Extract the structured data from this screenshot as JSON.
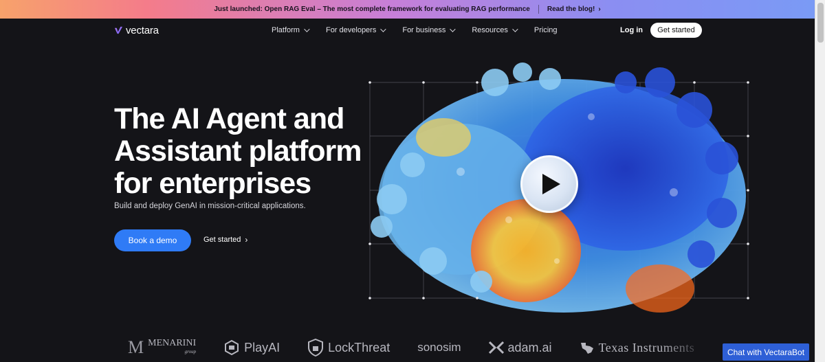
{
  "announcement": {
    "text": "Just launched: Open RAG Eval – The most complete framework for evaluating RAG performance",
    "link": "Read the blog!",
    "chevron": "›"
  },
  "brand": {
    "name": "vectara",
    "mark_icon": "vectara-logo-icon"
  },
  "nav": {
    "items": [
      {
        "label": "Platform",
        "has_dropdown": true
      },
      {
        "label": "For developers",
        "has_dropdown": true
      },
      {
        "label": "For business",
        "has_dropdown": true
      },
      {
        "label": "Resources",
        "has_dropdown": true
      },
      {
        "label": "Pricing",
        "has_dropdown": false
      }
    ],
    "login": "Log in",
    "get_started": "Get started"
  },
  "hero": {
    "title_line1": "The AI Agent and",
    "title_line2": "Assistant platform",
    "title_line3": "for enterprises",
    "subtitle": "Build and deploy GenAI in mission-critical applications.",
    "primary_cta": "Book a demo",
    "secondary_cta": "Get started",
    "secondary_chevron": "›",
    "video_play_icon": "play-icon"
  },
  "customer_logos": [
    {
      "name": "MENARINI",
      "sub": "group",
      "mark": "M"
    },
    {
      "name": "PlayAI"
    },
    {
      "name": "LockThreat"
    },
    {
      "name": "sonosim"
    },
    {
      "name": "adam.ai"
    },
    {
      "name": "Texas Instruments"
    }
  ],
  "chat_widget": {
    "label": "Chat with VectaraBot"
  },
  "colors": {
    "background": "#141418",
    "accent_blue": "#2f7bf6",
    "chat_blue": "#2e5fd6",
    "announce_gradient": [
      "#f7a26b",
      "#c77fd8",
      "#7a9af5"
    ]
  }
}
